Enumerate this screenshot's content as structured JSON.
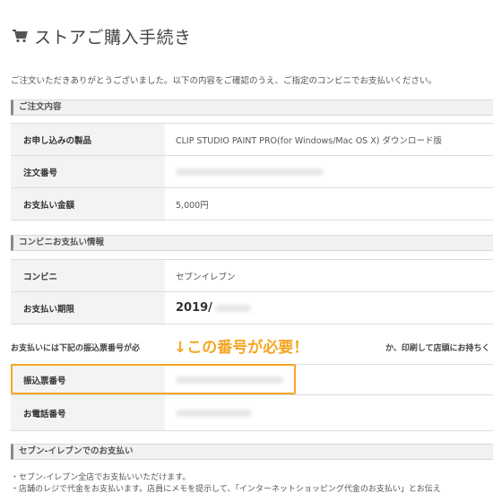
{
  "header": {
    "title": "ストアご購入手続き",
    "icon": "cart-icon"
  },
  "intro": "ご注文いただきありがとうございました。以下の内容をご確認のうえ、ご指定のコンビニでお支払いください。",
  "order": {
    "section_title": "ご注文内容",
    "rows": [
      {
        "label": "お申し込みの製品",
        "value": "CLIP STUDIO PAINT PRO(for Windows/Mac OS X) ダウンロード版"
      },
      {
        "label": "注文番号",
        "value": ""
      },
      {
        "label": "お支払い金額",
        "value": "5,000円"
      }
    ]
  },
  "convenience": {
    "section_title": "コンビニお支払い情報",
    "rows": [
      {
        "label": "コンビニ",
        "value": "セブンイレブン"
      },
      {
        "label": "お支払い期限",
        "value": "2019/"
      }
    ]
  },
  "notice": {
    "part1": "お支払いには下記の振込票番号が必",
    "part2": "か、印刷して店頭にお持ちく"
  },
  "callout": {
    "text": "↓この番号が必要！",
    "color": "#f5a623"
  },
  "payment": {
    "rows": [
      {
        "label": "振込票番号",
        "value": ""
      },
      {
        "label": "お電話番号",
        "value": ""
      }
    ]
  },
  "seven": {
    "section_title": "セブン-イレブンでのお支払い",
    "bullets": [
      "・セブン-イレブン全店でお支払いいただけます。",
      "・店舗のレジで代金をお支払います。店員にメモを提示して、「インターネットショッピング代金のお支払い」とお伝え"
    ]
  }
}
